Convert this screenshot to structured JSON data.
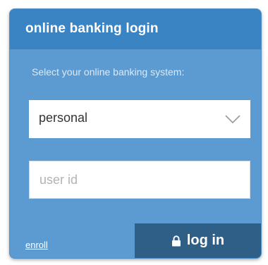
{
  "header": {
    "title": "online banking login"
  },
  "form": {
    "instruction": "Select your online banking system:",
    "system_select": {
      "selected": "personal"
    },
    "user_id": {
      "value": "",
      "placeholder": "user id"
    }
  },
  "footer": {
    "enroll_label": "enroll",
    "login_label": "log in"
  },
  "colors": {
    "header_bg": "#3b84c4",
    "card_bg": "#5b9bd2",
    "button_bg": "#2f5f87"
  },
  "icons": {
    "select_chevron": "chevron-down-icon",
    "login_lock": "lock-icon"
  }
}
